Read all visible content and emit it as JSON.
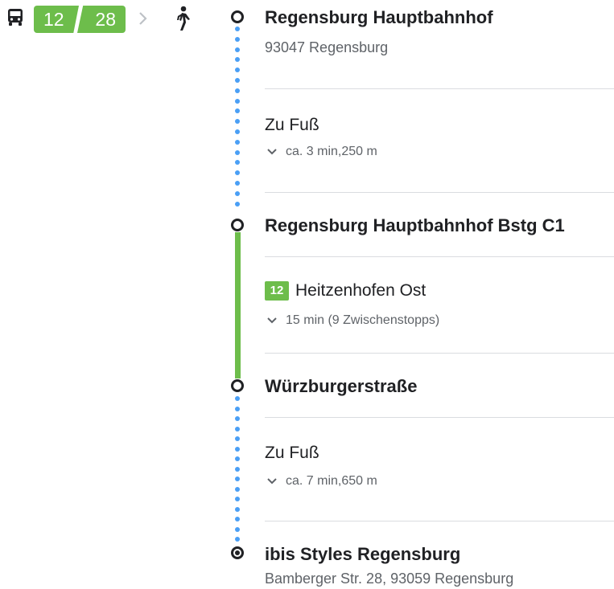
{
  "summary": {
    "bus_icon": "bus-icon",
    "route_segments": [
      "12",
      "28"
    ],
    "separator_icon": "chevron-right-icon",
    "walk_icon": "walking-icon",
    "accent_green": "#6dbd4b",
    "walk_dot_color": "#4a9ff5"
  },
  "steps": {
    "start": {
      "name": "Regensburg Hauptbahnhof",
      "address": "93047 Regensburg"
    },
    "walk1": {
      "mode": "Zu Fuß",
      "detail": "ca. 3 min,250 m"
    },
    "board": {
      "name": "Regensburg Hauptbahnhof Bstg C1"
    },
    "transit": {
      "line": "12",
      "destination": "Heitzenhofen Ost",
      "detail": "15 min (9 Zwischenstopps)"
    },
    "alight": {
      "name": "Würzburgerstraße"
    },
    "walk2": {
      "mode": "Zu Fuß",
      "detail": "ca. 7 min,650 m"
    },
    "end": {
      "name": "ibis Styles Regensburg",
      "address": "Bamberger Str. 28, 93059 Regensburg"
    }
  }
}
